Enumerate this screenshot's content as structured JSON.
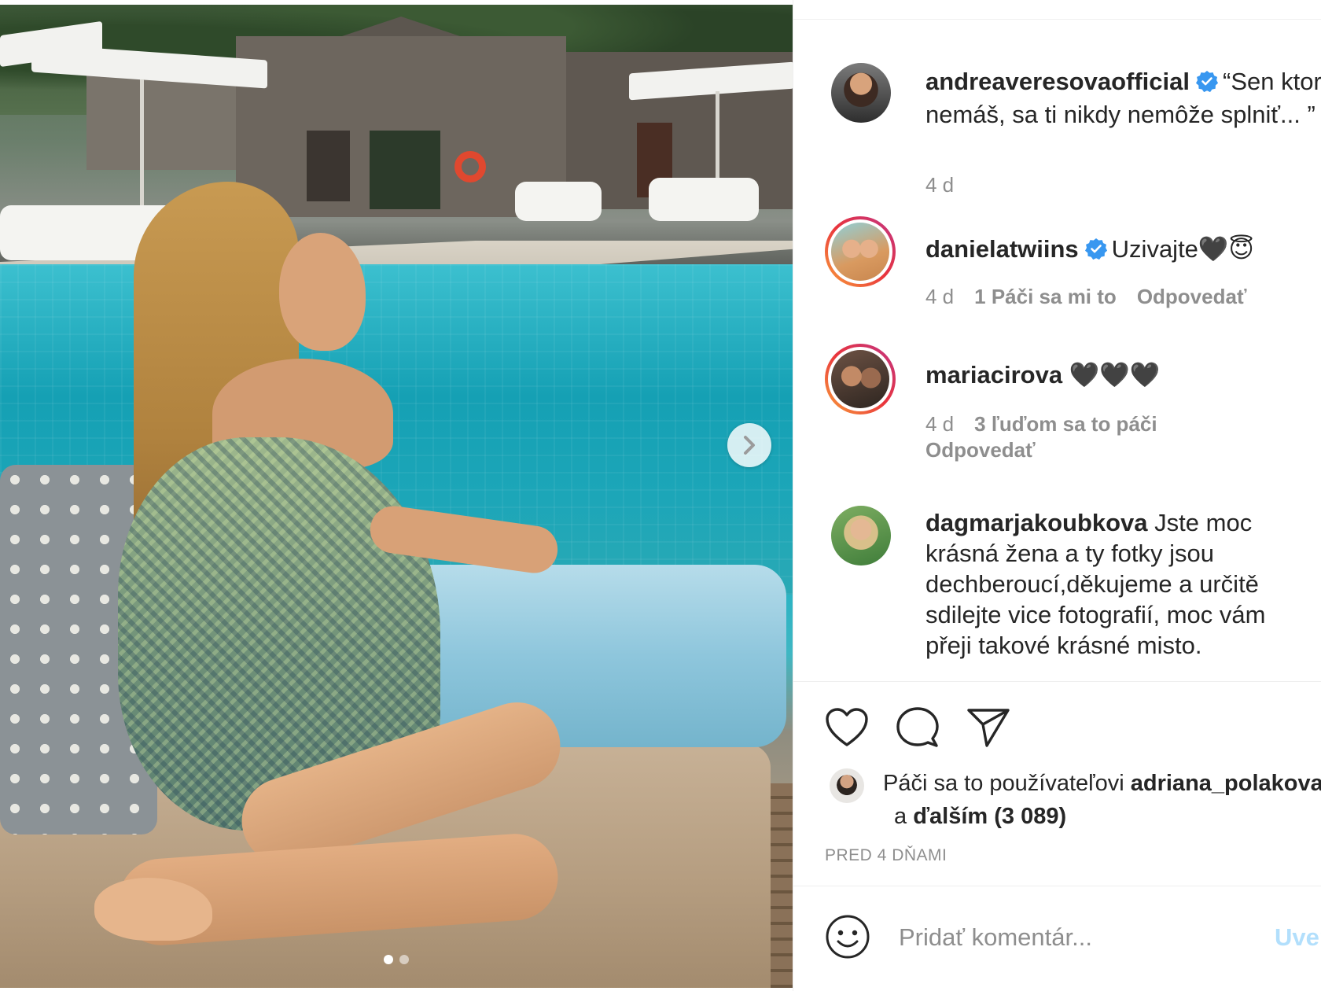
{
  "post": {
    "author": "andreaveresova",
    "caption_username": "andreaveresovaofficial",
    "caption_text_line1": "“Sen ktorý",
    "caption_text_line2": "nemáš, sa ti nikdy nemôže splniť... ”",
    "caption_time": "4 d"
  },
  "comments": [
    {
      "username": "danielatwiins",
      "verified": true,
      "text": "Uzivajte🖤😇",
      "time": "4 d",
      "likes": "1 Páči sa mi to",
      "reply": "Odpovedať"
    },
    {
      "username": "mariacirova",
      "verified": false,
      "text": "🖤🖤🖤",
      "time": "4 d",
      "likes": "3 ľuďom sa to páči",
      "reply": "Odpovedať"
    },
    {
      "username": "dagmarjakoubkova",
      "verified": false,
      "text": "Jste moc krásná žena a ty fotky jsou dechberoucí,děkujeme a určitě sdilejte vice fotografií, moc vám přeji takové krásné misto."
    }
  ],
  "likes": {
    "prefix": "Páči sa to používateľovi",
    "user": "adriana_polakova",
    "and": "a",
    "others": "ďalším (3 089)"
  },
  "posted_ago": "PRED 4 DŇAMI",
  "comment_box": {
    "placeholder": "Pridať komentár...",
    "post_label": "Uverejniť"
  },
  "carousel": {
    "current": 1,
    "total": 2
  },
  "colors": {
    "verified": "#3897f0",
    "muted": "#8e8e8e",
    "post_button_disabled": "#b2dffc"
  }
}
